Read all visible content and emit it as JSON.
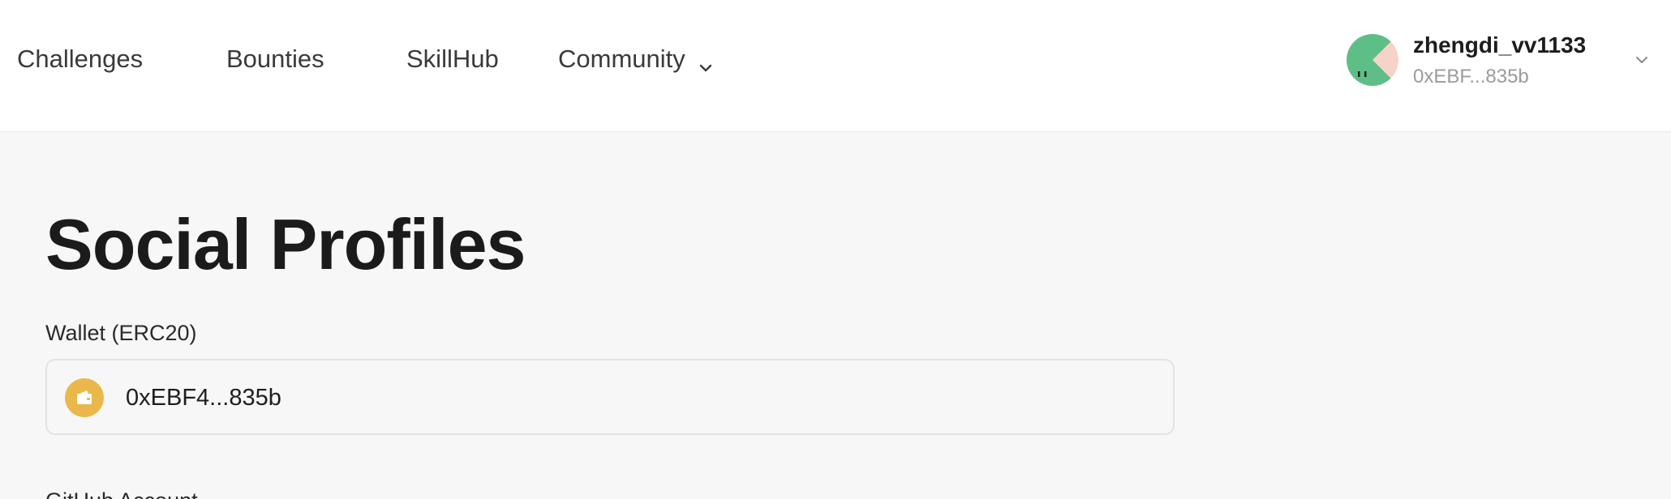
{
  "nav": {
    "items": [
      {
        "label": "Challenges"
      },
      {
        "label": "Bounties"
      },
      {
        "label": "SkillHub"
      },
      {
        "label": "Community",
        "icon": "chevron-down-icon"
      }
    ]
  },
  "user": {
    "username": "zhengdi_vv1133",
    "address": "0xEBF...835b",
    "avatar_icon": "avatar-icon",
    "menu_icon": "chevron-down-icon"
  },
  "main": {
    "title": "Social Profiles",
    "wallet": {
      "label": "Wallet (ERC20)",
      "value": "0xEBF4...835b",
      "icon": "wallet-icon"
    },
    "github": {
      "label": "GitHub Account"
    }
  },
  "colors": {
    "page_bg": "#f7f7f7",
    "header_bg": "#ffffff",
    "wallet_icon_bg": "#eab84a",
    "avatar_bg": "#f6d3c8",
    "avatar_fg": "#5dbf86"
  }
}
